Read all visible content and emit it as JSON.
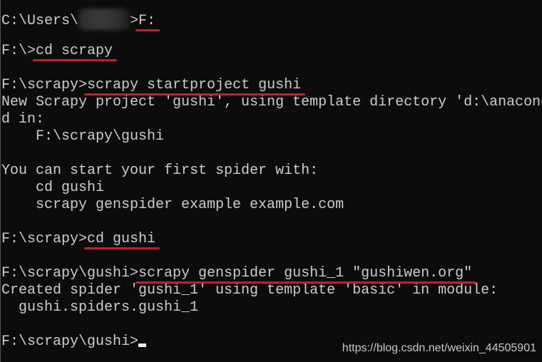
{
  "terminal": {
    "lines": [
      {
        "prompt": "C:\\Users\\",
        "redacted": true,
        "prompt_end": ">",
        "command": "F:",
        "underlined": true
      },
      {
        "text": ""
      },
      {
        "prompt": "F:\\>",
        "command": "cd scrapy",
        "underlined": true
      },
      {
        "text": ""
      },
      {
        "prompt": "F:\\scrapy>",
        "command": "scrapy startproject gushi",
        "underlined": true
      },
      {
        "text": "New Scrapy project 'gushi', using template directory 'd:\\anaconda"
      },
      {
        "text": "d in:"
      },
      {
        "text": "    F:\\scrapy\\gushi"
      },
      {
        "text": ""
      },
      {
        "text": "You can start your first spider with:"
      },
      {
        "text": "    cd gushi"
      },
      {
        "text": "    scrapy genspider example example.com"
      },
      {
        "text": ""
      },
      {
        "prompt": "F:\\scrapy>",
        "command": "cd gushi",
        "underlined": true
      },
      {
        "text": ""
      },
      {
        "prompt": "F:\\scrapy\\gushi>",
        "command": "scrapy genspider gushi_1 \"gushiwen.org\"",
        "underlined": true
      },
      {
        "text": "Created spider 'gushi_1' using template 'basic' in module:"
      },
      {
        "text": "  gushi.spiders.gushi_1"
      },
      {
        "text": ""
      },
      {
        "prompt": "F:\\scrapy\\gushi>",
        "command": "",
        "cursor": true
      }
    ]
  },
  "watermark": "https://blog.csdn.net/weixin_44505901",
  "colors": {
    "background": "#0c0c0c",
    "text": "#cccccc",
    "annotation": "#e8101c"
  }
}
